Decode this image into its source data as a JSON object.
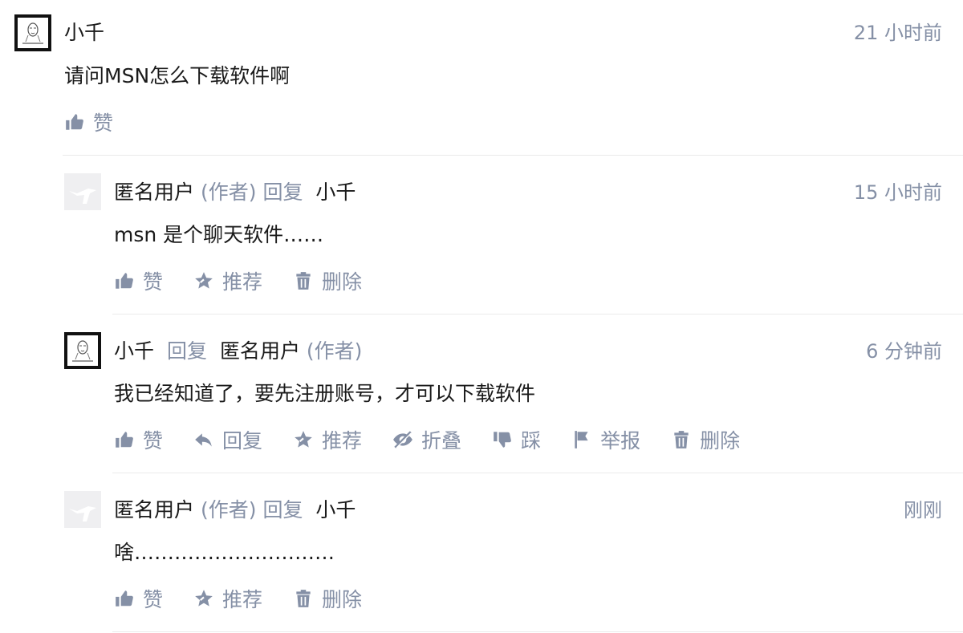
{
  "comments": [
    {
      "author": "小千",
      "time": "21 小时前",
      "content": "请问MSN怎么下载软件啊",
      "actions": {
        "like": "赞"
      }
    },
    {
      "author": "匿名用户",
      "author_tag": "(作者)",
      "reply_word": "回复",
      "reply_to": "小千",
      "time": "15 小时前",
      "content": "msn 是个聊天软件……",
      "actions": {
        "like": "赞",
        "recommend": "推荐",
        "delete": "删除"
      }
    },
    {
      "author": "小千",
      "reply_word": "回复",
      "reply_to": "匿名用户",
      "reply_to_tag": "(作者)",
      "time": "6 分钟前",
      "content": "我已经知道了，要先注册账号，才可以下载软件",
      "actions": {
        "like": "赞",
        "reply": "回复",
        "recommend": "推荐",
        "fold": "折叠",
        "dislike": "踩",
        "report": "举报",
        "delete": "删除"
      }
    },
    {
      "author": "匿名用户",
      "author_tag": "(作者)",
      "reply_word": "回复",
      "reply_to": "小千",
      "time": "刚刚",
      "content": "啥…………………………",
      "actions": {
        "like": "赞",
        "recommend": "推荐",
        "delete": "删除"
      }
    }
  ],
  "colors": {
    "meta_gray": "#8590a6",
    "text": "#1a1a1a",
    "divider": "#ebebeb"
  },
  "icons": [
    "thumbs-up-icon",
    "reply-arrow-icon",
    "star-icon",
    "eye-slash-icon",
    "thumbs-down-icon",
    "flag-icon",
    "trash-icon"
  ]
}
